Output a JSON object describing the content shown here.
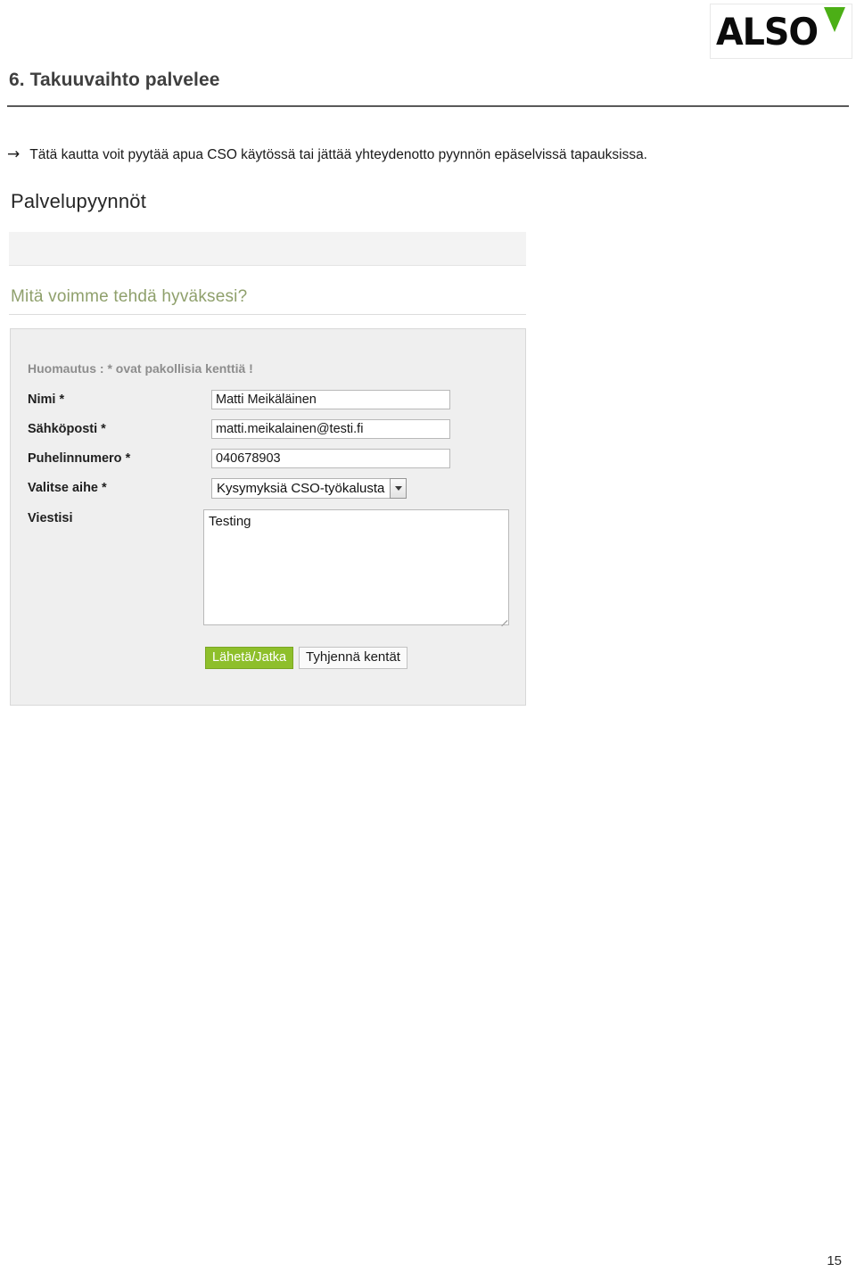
{
  "document": {
    "section_heading": "6. Takuuvaihto palvelee",
    "intro_arrow": "→",
    "intro_text": "Tätä kautta voit pyytää apua CSO käytössä tai jättää yhteydenotto pyynnön epäselvissä tapauksissa.",
    "page_number": "15"
  },
  "logo": {
    "wordmark": "ALSO",
    "accent_color": "#4caf16"
  },
  "screenshot": {
    "title": "Palvelupyynnöt",
    "subtitle": "Mitä voimme tehdä hyväksesi?",
    "subtitle_color": "#8fa06c",
    "note": "Huomautus : * ovat pakollisia kenttiä !",
    "fields": [
      {
        "label": "Nimi *",
        "value": "Matti Meikäläinen",
        "placeholder": "",
        "type": "text"
      },
      {
        "label": "Sähköposti *",
        "value": "matti.meikalainen@testi.fi",
        "placeholder": "",
        "type": "email"
      },
      {
        "label": "Puhelinnumero *",
        "value": "040678903",
        "placeholder": "",
        "type": "tel"
      }
    ],
    "topic": {
      "label": "Valitse aihe *",
      "selected": "Kysymyksiä CSO-työkalusta"
    },
    "message": {
      "label": "Viestisi",
      "value": "Testing",
      "placeholder": ""
    },
    "buttons": {
      "submit": "Lähetä/Jatka",
      "submit_color": "#8ebf2b",
      "clear": "Tyhjennä kentät"
    }
  }
}
